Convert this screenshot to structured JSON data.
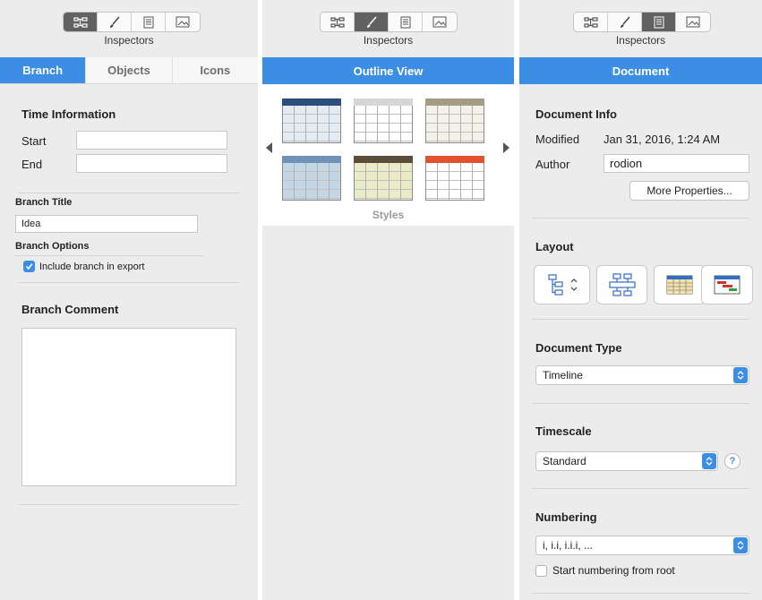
{
  "inspectors_label": "Inspectors",
  "colors": {
    "accent": "#3c8ee4",
    "segment_selected": "#616161",
    "panel_bg": "#ececec"
  },
  "left_panel": {
    "tabs": [
      "Branch",
      "Objects",
      "Icons"
    ],
    "active_tab": "Branch",
    "time_info_title": "Time Information",
    "start_label": "Start",
    "start_value": "",
    "end_label": "End",
    "end_value": "",
    "branch_title_label": "Branch Title",
    "branch_title_value": "Idea",
    "branch_options_label": "Branch Options",
    "include_export_label": "Include branch in export",
    "include_export_checked": true,
    "branch_comment_title": "Branch Comment",
    "branch_comment_value": ""
  },
  "middle_panel": {
    "header": "Outline View",
    "styles_label": "Styles",
    "style_thumbs": [
      {
        "header": "#2b4f7d",
        "fill": "#e4ebf3"
      },
      {
        "header": "#d6d6d6",
        "fill": "#ffffff"
      },
      {
        "header": "#a59a84",
        "fill": "#f4f1ea"
      },
      {
        "header": "#6f93b6",
        "fill": "#c4d6e4"
      },
      {
        "header": "#5c4d3a",
        "fill": "#ecebc8"
      },
      {
        "header": "#e0532e",
        "fill": "#ffffff"
      }
    ]
  },
  "right_panel": {
    "header": "Document",
    "doc_info_title": "Document Info",
    "modified_label": "Modified",
    "modified_value": "Jan 31, 2016, 1:24 AM",
    "author_label": "Author",
    "author_value": "rodion",
    "more_properties": "More Properties...",
    "layout_title": "Layout",
    "layout_icons": [
      "tree-layout-icon",
      "hierarchy-layout-icon",
      "table-layout-icon",
      "gantt-layout-icon"
    ],
    "doc_type_title": "Document Type",
    "doc_type_value": "Timeline",
    "timescale_title": "Timescale",
    "timescale_value": "Standard",
    "help_symbol": "?",
    "numbering_title": "Numbering",
    "numbering_value": "i, i.i, i.i.i, ...",
    "start_root_label": "Start numbering from root",
    "start_root_checked": false
  }
}
